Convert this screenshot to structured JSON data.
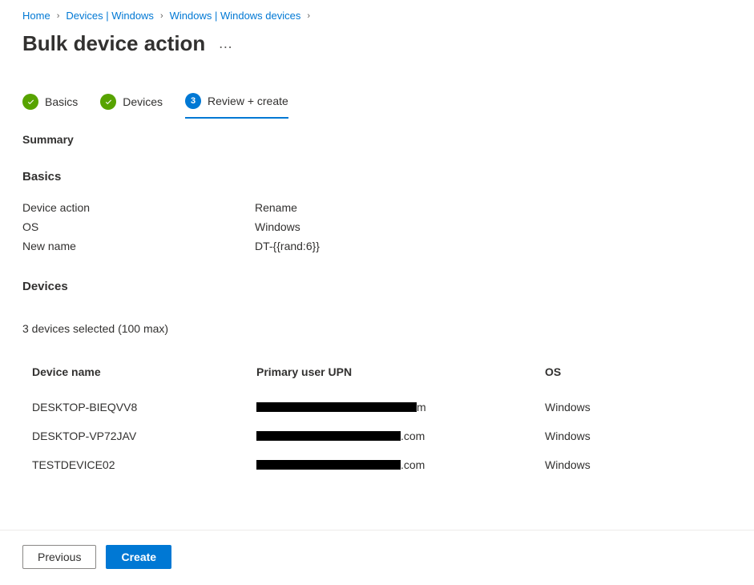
{
  "breadcrumb": {
    "items": [
      {
        "label": "Home"
      },
      {
        "label": "Devices | Windows"
      },
      {
        "label": "Windows | Windows devices"
      }
    ]
  },
  "page": {
    "title": "Bulk device action"
  },
  "tabs": [
    {
      "label": "Basics",
      "state": "done"
    },
    {
      "label": "Devices",
      "state": "done"
    },
    {
      "label": "Review + create",
      "state": "active",
      "num": "3"
    }
  ],
  "summary": {
    "heading": "Summary",
    "basics_heading": "Basics",
    "rows": [
      {
        "label": "Device action",
        "value": "Rename"
      },
      {
        "label": "OS",
        "value": "Windows"
      },
      {
        "label": "New name",
        "value": "DT-{{rand:6}}"
      }
    ],
    "devices_heading": "Devices",
    "selected_text": "3 devices selected (100 max)"
  },
  "table": {
    "headers": {
      "device_name": "Device name",
      "upn": "Primary user UPN",
      "os": "OS"
    },
    "rows": [
      {
        "name": "DESKTOP-BIEQVV8",
        "upn_suffix": "m",
        "os": "Windows"
      },
      {
        "name": "DESKTOP-VP72JAV",
        "upn_suffix": ".com",
        "os": "Windows"
      },
      {
        "name": "TESTDEVICE02",
        "upn_suffix": ".com",
        "os": "Windows"
      }
    ]
  },
  "footer": {
    "previous": "Previous",
    "create": "Create"
  }
}
